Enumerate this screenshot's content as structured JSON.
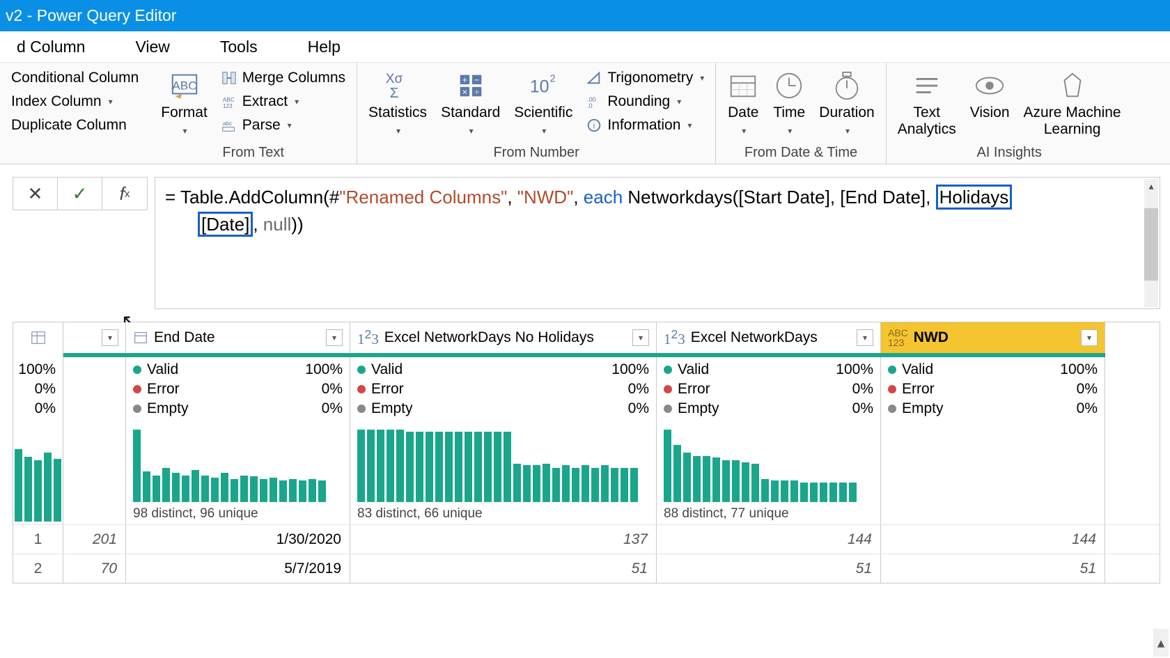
{
  "title": "v2 - Power Query Editor",
  "menu": {
    "active": "d Column",
    "items": [
      "View",
      "Tools",
      "Help"
    ]
  },
  "ribbon": {
    "col_btns": [
      "Conditional Column",
      "Index Column",
      "Duplicate Column"
    ],
    "format": "Format",
    "text_ops": [
      "Merge Columns",
      "Extract",
      "Parse"
    ],
    "from_text": "From Text",
    "num_large": [
      "Statistics",
      "Standard",
      "Scientific"
    ],
    "num_small": [
      "Trigonometry",
      "Rounding",
      "Information"
    ],
    "from_number": "From Number",
    "dt": [
      "Date",
      "Time",
      "Duration"
    ],
    "from_dt": "From Date & Time",
    "ai": [
      "Text\nAnalytics",
      "Vision",
      "Azure Machine\nLearning"
    ],
    "ai_label": "AI Insights"
  },
  "formula": {
    "pre1": "= Table.AddColumn(#",
    "str1": "\"Renamed Columns\"",
    "mid1": ", ",
    "str2": "\"NWD\"",
    "mid2": ", ",
    "kw": "each",
    "mid3": " Networkdays([Start Date], [End Date], ",
    "hl1": "Holidays",
    "line2_hl": "[Date]",
    "mid4": ", ",
    "null": "null",
    "tail": "))"
  },
  "columns": [
    {
      "name": "",
      "icon": "index"
    },
    {
      "name": "End Date",
      "icon": "date"
    },
    {
      "name": "Excel NetworkDays No Holidays",
      "icon": "num"
    },
    {
      "name": "Excel NetworkDays",
      "icon": "num"
    },
    {
      "name": "NWD",
      "icon": "abc",
      "selected": true
    }
  ],
  "qstats": {
    "labels": [
      "Valid",
      "Error",
      "Empty"
    ],
    "idx": [
      "100%",
      "0%",
      "0%"
    ],
    "cols": [
      {
        "v": "100%",
        "e": "0%",
        "m": "0%"
      },
      {
        "v": "100%",
        "e": "0%",
        "m": "0%"
      },
      {
        "v": "100%",
        "e": "0%",
        "m": "0%"
      },
      {
        "v": "100%",
        "e": "0%",
        "m": "0%"
      }
    ]
  },
  "dist": [
    {
      "label": "98 distinct, 96 unique",
      "bars": [
        95,
        40,
        35,
        45,
        38,
        35,
        42,
        35,
        32,
        38,
        30,
        35,
        34,
        30,
        32,
        28,
        30,
        28,
        30,
        28
      ]
    },
    {
      "label": "83 distinct, 66 unique",
      "bars": [
        95,
        95,
        95,
        95,
        95,
        92,
        92,
        92,
        92,
        92,
        92,
        92,
        92,
        92,
        92,
        92,
        50,
        48,
        48,
        50,
        45,
        48,
        45,
        48,
        45,
        48,
        45,
        45,
        45
      ]
    },
    {
      "label": "88 distinct, 77 unique",
      "bars": [
        95,
        75,
        65,
        60,
        60,
        58,
        55,
        55,
        52,
        50,
        30,
        28,
        28,
        28,
        26,
        26,
        26,
        26,
        26,
        26
      ]
    },
    {
      "label": "",
      "bars": []
    }
  ],
  "rows": [
    {
      "idx": "1",
      "c0": "201",
      "c1": "1/30/2020",
      "c2": "137",
      "c3": "144",
      "c4": "144"
    },
    {
      "idx": "2",
      "c0": "70",
      "c1": "5/7/2019",
      "c2": "51",
      "c3": "51",
      "c4": "51"
    }
  ]
}
